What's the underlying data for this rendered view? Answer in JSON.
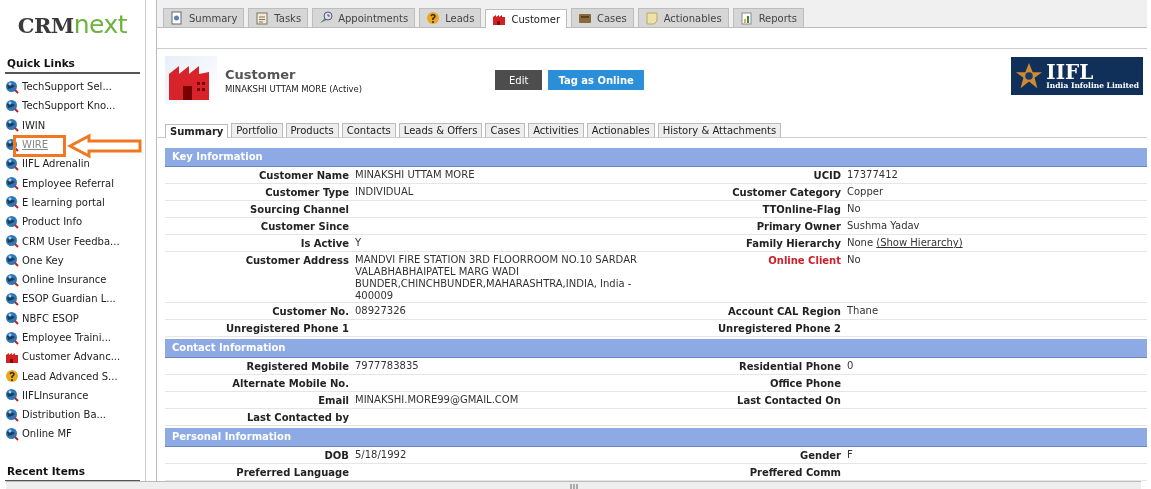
{
  "brand": {
    "primary": "CRM",
    "secondary": "next"
  },
  "sidebar": {
    "quick_links_title": "Quick Links",
    "recent_title": "Recent Items",
    "items": [
      {
        "label": "TechSupport Sel...",
        "kind": "globe",
        "highlighted": false
      },
      {
        "label": "TechSupport Kno...",
        "kind": "globe",
        "highlighted": false
      },
      {
        "label": "IWIN",
        "kind": "globe",
        "highlighted": false
      },
      {
        "label": "WIRE",
        "kind": "globe",
        "highlighted": true
      },
      {
        "label": "IIFL Adrenalin",
        "kind": "globe",
        "highlighted": false
      },
      {
        "label": "Employee Referral",
        "kind": "globe",
        "highlighted": false
      },
      {
        "label": "E learning portal",
        "kind": "globe",
        "highlighted": false
      },
      {
        "label": "Product Info",
        "kind": "globe",
        "highlighted": false
      },
      {
        "label": "CRM User Feedba...",
        "kind": "globe",
        "highlighted": false
      },
      {
        "label": "One Key",
        "kind": "globe",
        "highlighted": false
      },
      {
        "label": "Online Insurance",
        "kind": "globe",
        "highlighted": false
      },
      {
        "label": "ESOP Guardian L...",
        "kind": "globe",
        "highlighted": false
      },
      {
        "label": "NBFC ESOP",
        "kind": "globe",
        "highlighted": false
      },
      {
        "label": "Employee Traini...",
        "kind": "globe",
        "highlighted": false
      },
      {
        "label": "Customer Advanc...",
        "kind": "customer",
        "highlighted": false
      },
      {
        "label": "Lead Advanced S...",
        "kind": "lead",
        "highlighted": false
      },
      {
        "label": "IIFLInsurance",
        "kind": "globe",
        "highlighted": false
      },
      {
        "label": "Distribution Ba...",
        "kind": "globe",
        "highlighted": false
      },
      {
        "label": "Online MF",
        "kind": "globe",
        "highlighted": false
      }
    ]
  },
  "tabs": [
    {
      "label": "Summary",
      "kind": "summary",
      "selected": false
    },
    {
      "label": "Tasks",
      "kind": "tasks",
      "selected": false
    },
    {
      "label": "Appointments",
      "kind": "appointments",
      "selected": false
    },
    {
      "label": "Leads",
      "kind": "lead",
      "selected": false
    },
    {
      "label": "Customer",
      "kind": "customer",
      "selected": true
    },
    {
      "label": "Cases",
      "kind": "cases",
      "selected": false
    },
    {
      "label": "Actionables",
      "kind": "actionables",
      "selected": false
    },
    {
      "label": "Reports",
      "kind": "reports",
      "selected": false
    }
  ],
  "header": {
    "title": "Customer",
    "subtitle": "MINAKSHI UTTAM MORE (Active)",
    "buttons": [
      {
        "label": "Edit",
        "kind": "secondary"
      },
      {
        "label": "Tag as Online",
        "kind": "primary"
      }
    ],
    "logo": {
      "name": "IIFL",
      "tagline": "India Infoline Limited"
    }
  },
  "subtabs": [
    {
      "label": "Summary",
      "selected": true
    },
    {
      "label": "Portfolio",
      "selected": false
    },
    {
      "label": "Products",
      "selected": false
    },
    {
      "label": "Contacts",
      "selected": false
    },
    {
      "label": "Leads & Offers",
      "selected": false
    },
    {
      "label": "Cases",
      "selected": false
    },
    {
      "label": "Activities",
      "selected": false
    },
    {
      "label": "Actionables",
      "selected": false
    },
    {
      "label": "History & Attachments",
      "selected": false
    }
  ],
  "sections": [
    {
      "title": "Key Information",
      "rows": [
        {
          "cells": [
            {
              "label": "Customer Name",
              "value": "MINAKSHI UTTAM MORE",
              "alert": false
            },
            {
              "label": "UCID",
              "value": "17377412",
              "alert": false
            }
          ]
        },
        {
          "cells": [
            {
              "label": "Customer Type",
              "value": "INDIVIDUAL",
              "alert": false
            },
            {
              "label": "Customer Category",
              "value": "Copper",
              "alert": false
            }
          ]
        },
        {
          "cells": [
            {
              "label": "Sourcing Channel",
              "alert": false
            },
            {
              "label": "TTOnline-Flag",
              "value": "No",
              "alert": false
            }
          ]
        },
        {
          "cells": [
            {
              "label": "Customer Since",
              "alert": false
            },
            {
              "label": "Primary Owner",
              "value": "Sushma Yadav",
              "alert": false
            }
          ]
        },
        {
          "cells": [
            {
              "label": "Is Active",
              "value": "Y",
              "alert": false
            },
            {
              "label": "Family Hierarchy",
              "value": "None",
              "link": "(Show Hierarchy)",
              "alert": false
            }
          ]
        },
        {
          "cells": [
            {
              "label": "Customer Address",
              "value": "MANDVI FIRE STATION 3RD FLOORROOM NO.10 SARDAR VALABHABHAIPATEL MARG WADI BUNDER,CHINCHBUNDER,MAHARASHTRA,INDIA, India - 400009",
              "alert": false
            },
            {
              "label": "Online Client",
              "value": "No",
              "alert": true
            }
          ]
        },
        {
          "cells": [
            {
              "label": "Customer No.",
              "value": "08927326",
              "alert": false
            },
            {
              "label": "Account CAL Region",
              "value": "Thane",
              "alert": false
            }
          ]
        },
        {
          "cells": [
            {
              "label": "Unregistered Phone 1",
              "alert": false
            },
            {
              "label": "Unregistered Phone 2",
              "alert": false
            }
          ]
        }
      ]
    },
    {
      "title": "Contact Information",
      "rows": [
        {
          "cells": [
            {
              "label": "Registered Mobile",
              "value": "7977783835",
              "alert": false
            },
            {
              "label": "Residential Phone",
              "value": "0",
              "alert": false
            }
          ]
        },
        {
          "cells": [
            {
              "label": "Alternate Mobile No.",
              "alert": false
            },
            {
              "label": "Office Phone",
              "alert": false
            }
          ]
        },
        {
          "cells": [
            {
              "label": "Email",
              "value": "MINAKSHI.MORE99@GMAIL.COM",
              "alert": false
            },
            {
              "label": "Last Contacted On",
              "alert": false
            }
          ]
        },
        {
          "cells": [
            {
              "label": "Last Contacted by",
              "alert": false
            }
          ]
        }
      ]
    },
    {
      "title": "Personal Information",
      "rows": [
        {
          "cells": [
            {
              "label": "DOB",
              "value": "5/18/1992",
              "alert": false
            },
            {
              "label": "Gender",
              "value": "F",
              "alert": false
            }
          ]
        },
        {
          "cells": [
            {
              "label": "Preferred Language",
              "alert": false
            },
            {
              "label": "Preffered Comm",
              "alert": false
            }
          ]
        }
      ]
    }
  ]
}
